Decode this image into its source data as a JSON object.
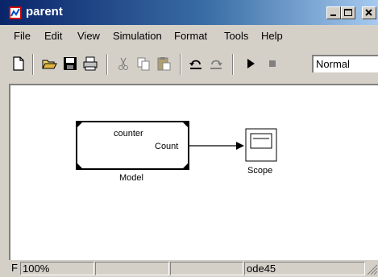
{
  "window": {
    "title": "parent"
  },
  "menu": {
    "items": [
      "File",
      "Edit",
      "View",
      "Simulation",
      "Format",
      "Tools",
      "Help"
    ]
  },
  "toolbar": {
    "icons": [
      "new-file-icon",
      "open-folder-icon",
      "save-icon",
      "print-icon",
      "cut-icon",
      "copy-icon",
      "paste-icon",
      "undo-icon",
      "redo-icon",
      "run-icon",
      "stop-icon"
    ],
    "sim_mode": "Normal"
  },
  "diagram": {
    "model_block": {
      "inner_label": "counter",
      "port_label": "Count",
      "caption": "Model"
    },
    "scope_block": {
      "caption": "Scope"
    }
  },
  "status": {
    "left_fragment": "F",
    "zoom": "100%",
    "solver": "ode45"
  },
  "colors": {
    "titlebar_start": "#0a246a",
    "titlebar_end": "#a6caf0",
    "chrome": "#d4d0c8"
  }
}
